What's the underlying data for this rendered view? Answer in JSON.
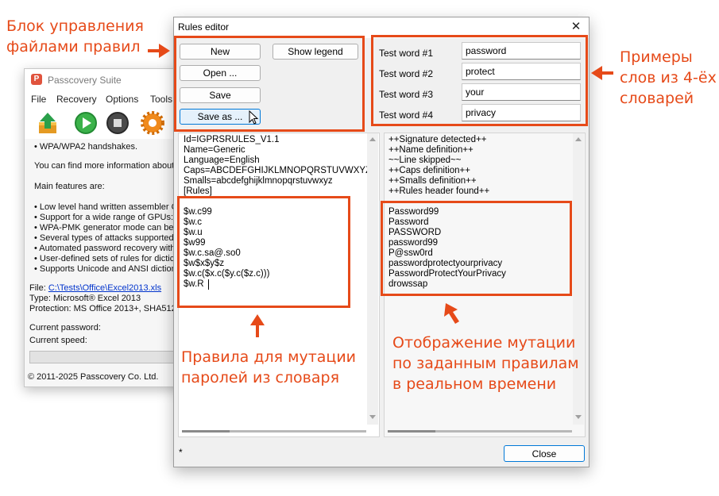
{
  "background_window": {
    "title": "Passcovery Suite",
    "app_icon_letter": "P",
    "menu": [
      "File",
      "Recovery",
      "Options",
      "Tools"
    ],
    "content_lines": [
      "• WPA/WPA2 handshakes.",
      "You can find more information about",
      "Main features are:",
      "• Low level hand written assembler C",
      "• Support for a wide range of GPUs:",
      "• WPA-PMK generator mode can be u",
      "• Several types of attacks supported",
      "• Automated password recovery with",
      "• User-defined sets of rules for dictic",
      "• Supports Unicode and ANSI diction"
    ],
    "file_label": "File:",
    "file_path": "C:\\Tests\\Office\\Excel2013.xls",
    "type_line": "Type: Microsoft® Excel 2013",
    "protection_line": "Protection: MS Office 2013+, SHA512",
    "current_password_label": "Current password:",
    "current_speed_label": "Current speed:",
    "footer": "© 2011-2025 Passcovery Co. Ltd."
  },
  "dialog": {
    "title": "Rules editor",
    "close_glyph": "✕",
    "buttons": {
      "new": "New",
      "show_legend": "Show legend",
      "open": "Open ...",
      "save": "Save",
      "save_as": "Save as ..."
    },
    "test_words": [
      {
        "label": "Test word #1",
        "value": "password"
      },
      {
        "label": "Test word #2",
        "value": "protect"
      },
      {
        "label": "Test word #3",
        "value": "your"
      },
      {
        "label": "Test word #4",
        "value": "privacy"
      }
    ],
    "rules_header": [
      "Id=IGPRSRULES_V1.1",
      "Name=Generic",
      "Language=English",
      "Caps=ABCDEFGHIJKLMNOPQRSTUVWXYZ",
      "Smalls=abcdefghijklmnopqrstuvwxyz",
      "[Rules]"
    ],
    "rules": [
      "$w.c99",
      "$w.c",
      "$w.u",
      "$w99",
      "$w.c.sa@.so0",
      "$w$x$y$z",
      "$w.c($x.c($y.c($z.c)))",
      "$w.R"
    ],
    "parse_log": [
      "++Signature detected++",
      "++Name definition++",
      "~~Line skipped~~",
      "++Caps definition++",
      "++Smalls definition++",
      "++Rules header found++"
    ],
    "mutations": [
      "Password99",
      "Password",
      "PASSWORD",
      "password99",
      "P@ssw0rd",
      "passwordprotectyourprivacy",
      "PasswordProtectYourPrivacy",
      "drowssap"
    ],
    "status": "*",
    "close_button": "Close"
  },
  "annotations": {
    "file_block": [
      "Блок управления",
      "файлами правил"
    ],
    "examples": [
      "Примеры",
      "слов из 4-ёх",
      "словарей"
    ],
    "rules": [
      "Правила для мутации",
      "паролей из словаря"
    ],
    "mutation_display": [
      "Отображение мутации",
      "по заданным правилам",
      "в реальном времени"
    ]
  },
  "colors": {
    "annotation": "#e64a19",
    "dialog_bg": "#f0f0f0",
    "active_button": "#e5f1fb",
    "active_border": "#0078d7"
  }
}
